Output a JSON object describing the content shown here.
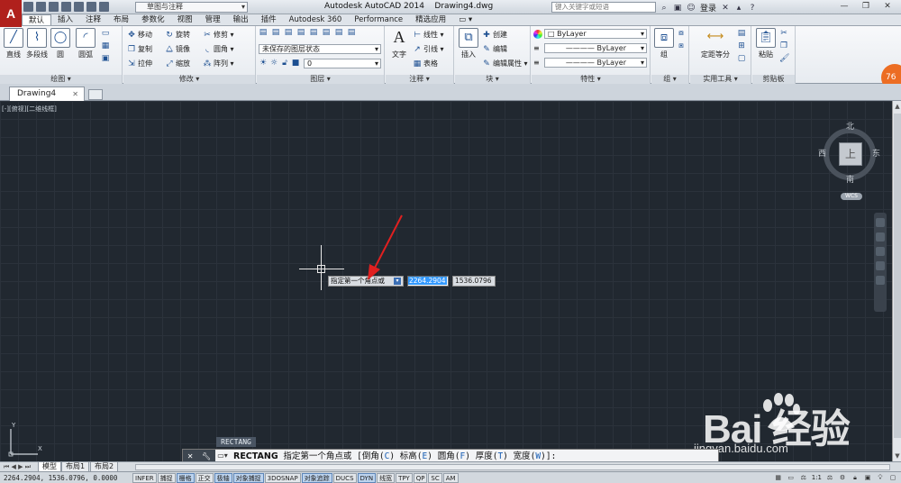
{
  "titlebar": {
    "app_logo": "A",
    "workspace": "草图与注释",
    "title": "Autodesk AutoCAD 2014    Drawing4.dwg",
    "search_placeholder": "键入关键字或短语",
    "login": "登录",
    "window_controls": [
      "—",
      "❐",
      "✕"
    ]
  },
  "ribbon_tabs": [
    "默认",
    "插入",
    "注释",
    "布局",
    "参数化",
    "视图",
    "管理",
    "输出",
    "插件",
    "Autodesk 360",
    "Performance",
    "精选应用",
    "▭ ▾"
  ],
  "panels": {
    "draw": {
      "title": "绘图 ▾",
      "buttons": [
        "直线",
        "多段线",
        "圆",
        "圆弧"
      ]
    },
    "modify": {
      "title": "修改 ▾",
      "rows": [
        [
          "移动",
          "旋转",
          "修剪 ▾"
        ],
        [
          "复制",
          "镜像",
          "圆角 ▾"
        ],
        [
          "拉伸",
          "缩放",
          "阵列 ▾"
        ]
      ]
    },
    "layers": {
      "title": "图层 ▾",
      "layer_state": "未保存的图层状态",
      "current_layer": "0"
    },
    "annotation": {
      "title": "注释 ▾",
      "text_button": "文字",
      "items": [
        "线性 ▾",
        "引线 ▾",
        "表格"
      ]
    },
    "block": {
      "title": "块 ▾",
      "insert_button": "插入",
      "items": [
        "创建",
        "编辑",
        "编辑属性 ▾"
      ]
    },
    "properties": {
      "title": "特性 ▾",
      "color": "ByLayer",
      "linetype": "ByLayer",
      "lineweight": "ByLayer"
    },
    "groups": {
      "title": "组 ▾",
      "button": "组"
    },
    "utilities": {
      "title": "实用工具 ▾",
      "button": "定距等分"
    },
    "clipboard": {
      "title": "剪贴板",
      "button": "粘贴"
    },
    "badge": "76"
  },
  "file_tab": {
    "name": "Drawing4",
    "close": "✕"
  },
  "viewport": {
    "label": "[-][俯视][二维线框]",
    "viewcube": {
      "face": "上",
      "north": "北",
      "south": "南",
      "east": "东",
      "west": "西",
      "wcs": "WCS"
    }
  },
  "dynamic_input": {
    "prompt": "指定第一个角点或",
    "x_value": "2264.2904",
    "y_value": "1536.0796"
  },
  "command": {
    "hint": "RECTANG",
    "name": "RECTANG",
    "prompt": "指定第一个角点或",
    "options": [
      {
        "label": "倒角",
        "key": "C"
      },
      {
        "label": "标高",
        "key": "E"
      },
      {
        "label": "圆角",
        "key": "F"
      },
      {
        "label": "厚度",
        "key": "T"
      },
      {
        "label": "宽度",
        "key": "W"
      }
    ],
    "suffix": "]:"
  },
  "layout_tabs": [
    "模型",
    "布局1",
    "布局2"
  ],
  "statusbar": {
    "coords": "2264.2904, 1536.0796, 0.0000",
    "toggles": [
      {
        "label": "INFER",
        "on": false
      },
      {
        "label": "捕捉",
        "on": false
      },
      {
        "label": "栅格",
        "on": true
      },
      {
        "label": "正交",
        "on": false
      },
      {
        "label": "极轴",
        "on": true
      },
      {
        "label": "对象捕捉",
        "on": true
      },
      {
        "label": "3DOSNAP",
        "on": false
      },
      {
        "label": "对象追踪",
        "on": true
      },
      {
        "label": "DUCS",
        "on": false
      },
      {
        "label": "DYN",
        "on": true
      },
      {
        "label": "线宽",
        "on": false
      },
      {
        "label": "TPY",
        "on": false
      },
      {
        "label": "QP",
        "on": false
      },
      {
        "label": "SC",
        "on": false
      },
      {
        "label": "AM",
        "on": false
      }
    ],
    "scale": "1:1"
  },
  "watermark": {
    "brand": "Bai  经验",
    "url": "jingyan.baidu.com"
  },
  "colors": {
    "canvas": "#212830",
    "grid": "#2b323b",
    "accent_red": "#b0201c",
    "selection": "#3399ff"
  }
}
